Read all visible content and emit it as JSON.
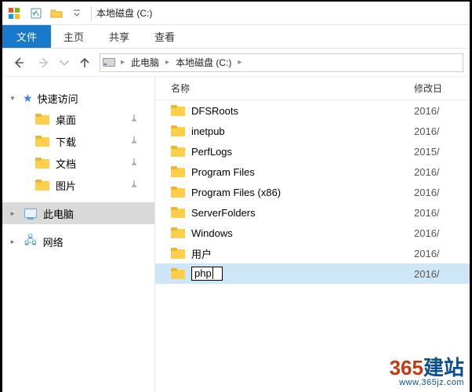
{
  "title": "本地磁盘 (C:)",
  "ribbon": {
    "file": "文件",
    "home": "主页",
    "share": "共享",
    "view": "查看"
  },
  "breadcrumb": {
    "this_pc": "此电脑",
    "drive": "本地磁盘 (C:)"
  },
  "sidebar": {
    "quick": "快速访问",
    "desktop": "桌面",
    "downloads": "下载",
    "documents": "文档",
    "pictures": "图片",
    "this_pc": "此电脑",
    "network": "网络"
  },
  "columns": {
    "name": "名称",
    "date": "修改日"
  },
  "rows": [
    {
      "name": "DFSRoots",
      "date": "2016/"
    },
    {
      "name": "inetpub",
      "date": "2016/"
    },
    {
      "name": "PerfLogs",
      "date": "2015/"
    },
    {
      "name": "Program Files",
      "date": "2016/"
    },
    {
      "name": "Program Files (x86)",
      "date": "2016/"
    },
    {
      "name": "ServerFolders",
      "date": "2016/"
    },
    {
      "name": "Windows",
      "date": "2016/"
    },
    {
      "name": "用户",
      "date": "2016/"
    },
    {
      "name": "php",
      "date": "2016/",
      "editing": true,
      "selected": true
    }
  ],
  "watermark": {
    "d365": "365",
    "jz": "建站",
    "url": "www.365jz.com"
  }
}
